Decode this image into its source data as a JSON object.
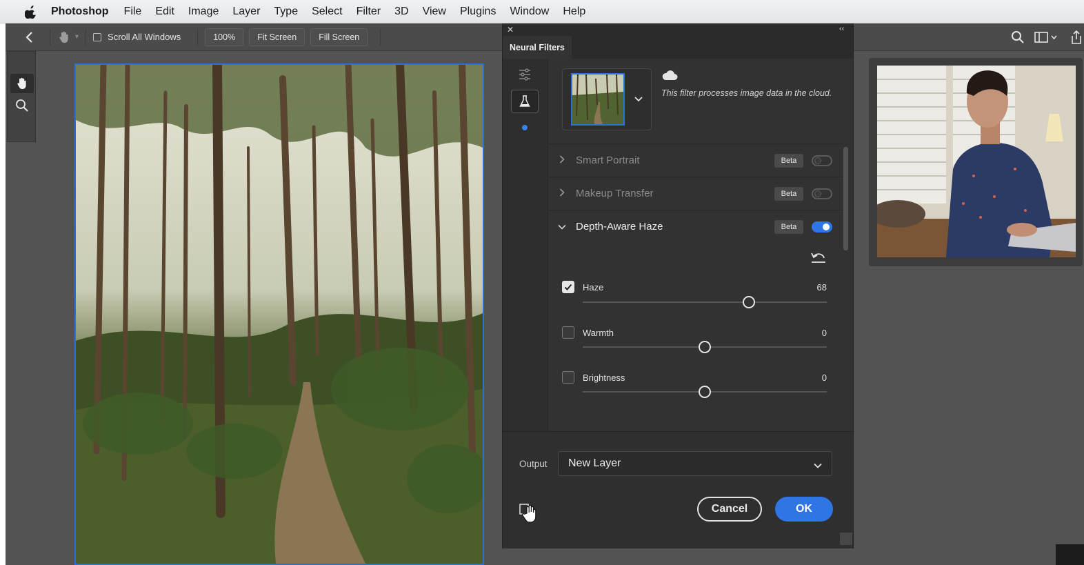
{
  "menubar": {
    "app_name": "Photoshop",
    "menus": [
      "File",
      "Edit",
      "Image",
      "Layer",
      "Type",
      "Select",
      "Filter",
      "3D",
      "View",
      "Plugins",
      "Window",
      "Help"
    ]
  },
  "options_bar": {
    "scroll_all_windows": "Scroll All Windows",
    "zoom": "100%",
    "fit_screen": "Fit Screen",
    "fill_screen": "Fill Screen"
  },
  "neural_filters": {
    "title": "Neural Filters",
    "cloud_notice": "This filter processes image data in the cloud.",
    "filters": [
      {
        "name": "Smart Portrait",
        "badge": "Beta",
        "enabled": false
      },
      {
        "name": "Makeup Transfer",
        "badge": "Beta",
        "enabled": false
      },
      {
        "name": "Depth-Aware Haze",
        "badge": "Beta",
        "enabled": true
      }
    ],
    "sliders": [
      {
        "label": "Haze",
        "value": "68",
        "checked": true,
        "fraction": 0.68
      },
      {
        "label": "Warmth",
        "value": "0",
        "checked": false,
        "fraction": 0.5
      },
      {
        "label": "Brightness",
        "value": "0",
        "checked": false,
        "fraction": 0.5
      }
    ],
    "output_label": "Output",
    "output_value": "New Layer",
    "cancel": "Cancel",
    "ok": "OK"
  },
  "colors": {
    "accent": "#2f75e6",
    "panel": "#323232",
    "workspace": "#535353"
  }
}
